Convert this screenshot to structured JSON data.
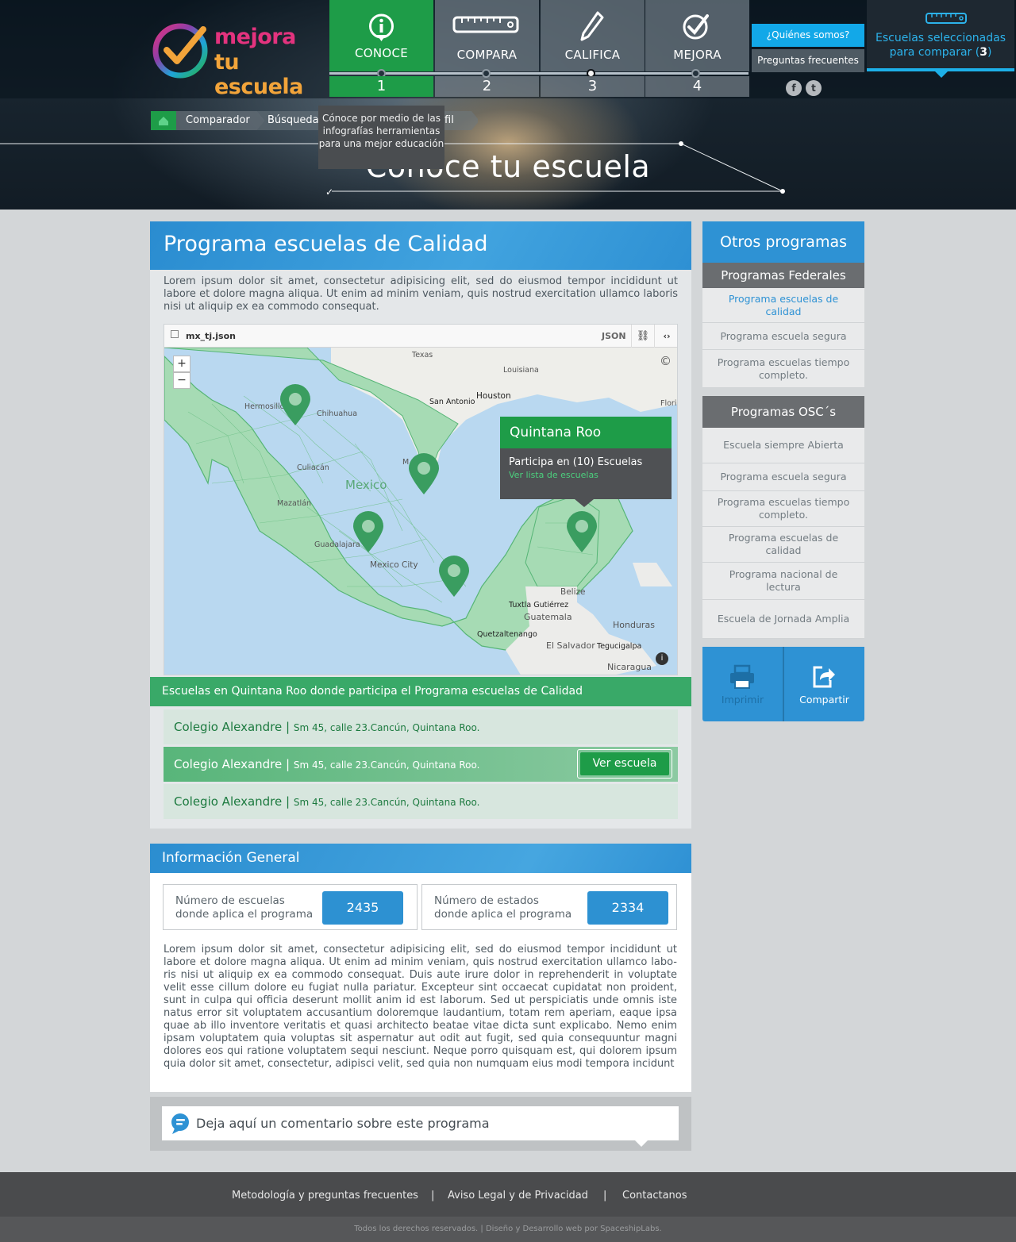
{
  "brand": {
    "line1": "mejora",
    "line2": "tu escuela"
  },
  "steps": [
    {
      "label": "CONOCE",
      "num": "1"
    },
    {
      "label": "COMPARA",
      "num": "2"
    },
    {
      "label": "CALIFICA",
      "num": "3"
    },
    {
      "label": "MEJORA",
      "num": "4"
    }
  ],
  "nav": {
    "about": "¿Quiénes somos?",
    "faq": "Preguntas frecuentes",
    "social": [
      "f",
      "t"
    ]
  },
  "compare": {
    "line1": "Escuelas seleccionadas",
    "line2_prefix": "para comparar (",
    "count": "3",
    "line2_suffix": ")"
  },
  "breadcrumb": {
    "items": [
      "Comparador",
      "Búsqueda",
      "fil"
    ]
  },
  "tooltip": "Cónoce por medio de las infografías herramientas para una mejor educación",
  "hero_title": "Conoce tu escuela",
  "main": {
    "title": "Programa escuelas de Calidad",
    "intro": "Lorem ipsum dolor sit amet, consectetur adipisicing elit, sed do eiusmod tempor incididunt ut labore et dolore magna aliqua. Ut enim ad minim veniam, quis nostrud exercitation ullamco laboris nisi ut aliquip ex ea commodo consequat."
  },
  "map": {
    "filename": "mx_tj.json",
    "format": "JSON",
    "zoom_in": "+",
    "zoom_out": "−",
    "labels": [
      "Texas",
      "Louisiana",
      "San Antonio",
      "Houston",
      "Hermosillo",
      "Chihuahua",
      "Culiacán",
      "Mexico",
      "Mazatlán",
      "Guadalajara",
      "Mexico City",
      "Belize",
      "Tuxtla Gutiérrez",
      "Guatemala",
      "Honduras",
      "Quetzaltenango",
      "El Salvador",
      "Tegucigalpa",
      "Nicaragua",
      "Florid",
      "M"
    ],
    "popup": {
      "title": "Quintana Roo",
      "text": "Participa en (10) Escuelas",
      "link": "Ver lista de escuelas"
    }
  },
  "schools_header": "Escuelas en Quintana Roo donde participa el Programa escuelas de Calidad",
  "schools": [
    {
      "name": "Colegio Alexandre",
      "sep": " | ",
      "address": "Sm 45, calle 23.Cancún, Quintana Roo."
    },
    {
      "name": "Colegio Alexandre",
      "sep": " | ",
      "address": "Sm 45, calle 23.Cancún, Quintana Roo."
    },
    {
      "name": "Colegio Alexandre",
      "sep": " | ",
      "address": "Sm 45, calle 23.Cancún, Quintana Roo."
    }
  ],
  "ver_escuela": "Ver escuela",
  "info": {
    "title": "Información General",
    "stats": [
      {
        "line1": "Número de escuelas",
        "line2": "donde aplica el programa",
        "value": "2435"
      },
      {
        "line1": "Número de estados",
        "line2": "donde aplica el programa",
        "value": "2334"
      }
    ],
    "body": "Lorem ipsum dolor sit amet, consectetur adipisicing elit, sed do eiusmod tempor incididunt ut labore et dolore magna aliqua. Ut enim ad minim veniam, quis nostrud exercitation ullamco labo-ris nisi ut aliquip ex ea commodo consequat. Duis aute irure dolor in reprehenderit in voluptate velit esse cillum dolore eu fugiat nulla pariatur. Excepteur sint occaecat cupidatat non proident, sunt in culpa qui officia deserunt mollit anim id est laborum. Sed ut perspiciatis unde omnis iste natus error sit voluptatem accusantium doloremque laudantium, totam rem aperiam, eaque ipsa quae ab illo inventore veritatis et quasi architecto beatae vitae dicta sunt explicabo. Nemo enim ipsam voluptatem quia voluptas sit aspernatur aut odit aut fugit, sed quia consequuntur magni dolores eos qui ratione voluptatem sequi nesciunt. Neque porro quisquam est, qui dolorem ipsum quia dolor sit amet, consectetur, adipisci velit, sed quia non numquam eius modi tempora incidunt"
  },
  "comment_placeholder": "Deja aquí un comentario sobre este programa",
  "sidebar": {
    "title": "Otros programas",
    "federal_title": "Programas Federales",
    "federal": [
      "Programa escuelas de calidad",
      "Programa escuela segura",
      "Programa escuelas tiempo completo."
    ],
    "osc_title": "Programas OSC´s",
    "osc": [
      "Escuela siempre Abierta",
      "Programa escuela segura",
      "Programa escuelas tiempo completo.",
      "Programa escuelas de calidad",
      "Programa nacional de lectura",
      "Escuela de Jornada Amplia"
    ],
    "print": "Imprimir",
    "share": "Compartir"
  },
  "footer": {
    "links": [
      "Metodología y preguntas frecuentes",
      "Aviso Legal  y  de Privacidad",
      "Contactanos"
    ],
    "sep": "|",
    "copyright": "Todos los derechos reservados. | Diseño y Desarrollo web por SpaceshipLabs."
  },
  "colors": {
    "green": "#1e9c48",
    "blue": "#2e92d4",
    "dark": "#1e2831",
    "cyan": "#1db0e8"
  }
}
